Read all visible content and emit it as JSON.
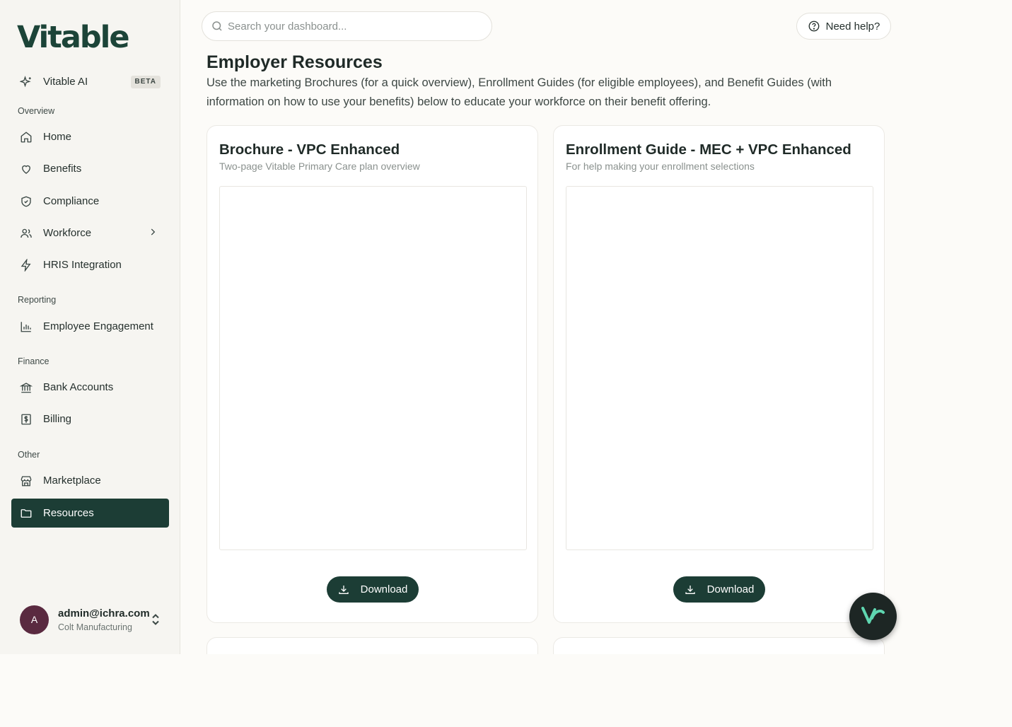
{
  "app": {
    "logo_text": "Vitable"
  },
  "sidebar": {
    "ai_item": {
      "label": "Vitable AI",
      "badge": "BETA"
    },
    "sections": {
      "overview": "Overview",
      "reporting": "Reporting",
      "finance": "Finance",
      "other": "Other"
    },
    "items": {
      "home": "Home",
      "benefits": "Benefits",
      "compliance": "Compliance",
      "workforce": "Workforce",
      "hris": "HRIS Integration",
      "engagement": "Employee Engagement",
      "bank": "Bank Accounts",
      "billing": "Billing",
      "marketplace": "Marketplace",
      "resources": "Resources"
    },
    "active_item": "Resources",
    "user": {
      "initial": "A",
      "email": "admin@ichra.com",
      "org": "Colt Manufacturing"
    }
  },
  "header": {
    "search_placeholder": "Search your dashboard...",
    "help_label": "Need help?"
  },
  "main": {
    "title": "Employer Resources",
    "description": "Use the marketing Brochures (for a quick overview), Enrollment Guides (for eligible employees), and Benefit Guides (with information on how to use your benefits) below to educate your workforce on their benefit offering.",
    "cards": [
      {
        "title": "Brochure - VPC Enhanced",
        "subtitle": "Two-page Vitable Primary Care plan overview",
        "button": "Download"
      },
      {
        "title": "Enrollment Guide - MEC + VPC Enhanced",
        "subtitle": "For help making your enrollment selections",
        "button": "Download"
      }
    ]
  },
  "colors": {
    "brand": "#1c3d35",
    "logo": "#1c4438",
    "avatar": "#5a2a40"
  }
}
